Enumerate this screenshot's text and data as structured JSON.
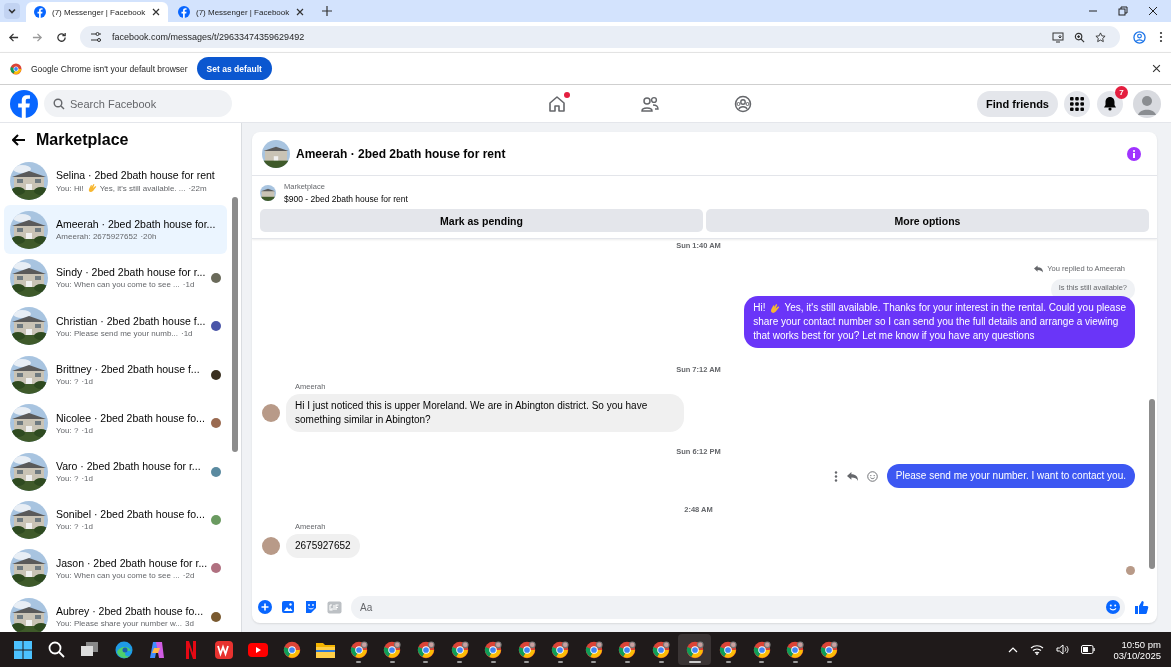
{
  "browser": {
    "tabs": [
      {
        "title": "(7) Messenger | Facebook",
        "selected": true
      },
      {
        "title": "(7) Messenger | Facebook",
        "selected": false
      }
    ],
    "address": "facebook.com/messages/t/29633474359629492",
    "infobar": {
      "text": "Google Chrome isn't your default browser",
      "button": "Set as default"
    }
  },
  "header": {
    "search": {
      "placeholder": "Search Facebook"
    },
    "home_unread": true,
    "find_friends": "Find friends",
    "notifications": "7"
  },
  "sidebar": {
    "title": "Marketplace",
    "items": [
      {
        "title": "Selina · 2bed 2bath house for rent",
        "lead": "You: Hi!",
        "preview": "Yes, it's still available. ...",
        "time": "·22m",
        "selected": false,
        "seen": false
      },
      {
        "title": "Ameerah · 2bed 2bath house for...",
        "preview": "Ameerah: 2675927652",
        "time": "·20h",
        "selected": true,
        "seen": false
      },
      {
        "title": "Sindy · 2bed 2bath house for r...",
        "preview": "You: When can you come to see ...",
        "time": "·1d",
        "selected": false,
        "seen": true,
        "color": "#6a6a5a"
      },
      {
        "title": "Christian · 2bed 2bath house f...",
        "preview": "You: Please send me your numb...",
        "time": "·1d",
        "selected": false,
        "seen": true,
        "color": "#4a55a8"
      },
      {
        "title": "Brittney · 2bed 2bath house f...",
        "preview": "You: ?",
        "time": "·1d",
        "selected": false,
        "seen": true,
        "color": "#3a3020"
      },
      {
        "title": "Nicolee · 2bed 2bath house fo...",
        "preview": "You: ?",
        "time": "·1d",
        "selected": false,
        "seen": true,
        "color": "#9a6a50"
      },
      {
        "title": "Varo · 2bed 2bath house for r...",
        "preview": "You: ?",
        "time": "·1d",
        "selected": false,
        "seen": true,
        "color": "#5a8aa0"
      },
      {
        "title": "Sonibel · 2bed 2bath house fo...",
        "preview": "You: ?",
        "time": "·1d",
        "selected": false,
        "seen": true,
        "color": "#6a9a60"
      },
      {
        "title": "Jason · 2bed 2bath house for r...",
        "preview": "You: When can you come to see ...",
        "time": "·2d",
        "selected": false,
        "seen": true,
        "color": "#b07080"
      },
      {
        "title": "Aubrey · 2bed 2bath house fo...",
        "preview": "You: Please share your number w...",
        "time": "3d",
        "selected": false,
        "seen": true,
        "color": "#7a5a30"
      }
    ]
  },
  "chat": {
    "title": "Ameerah · 2bed 2bath house for rent",
    "listing": {
      "label": "Marketplace",
      "text": "$900 - 2bed 2bath house for rent"
    },
    "actions": [
      "Mark as pending",
      "More options"
    ],
    "messages": [
      {
        "kind": "time",
        "text": "Sun 1:40 AM"
      },
      {
        "kind": "reply_note",
        "text": "You replied to Ameerah"
      },
      {
        "kind": "quote",
        "text": "Is this still available?"
      },
      {
        "kind": "outgoing",
        "lead": "Hi!",
        "lines": [
          "Yes, it's still available. Thanks for your interest in the rental. Could you please",
          "share your contact number so I can send you the full details and arrange a viewing",
          "that works best for you? Let me know if you have any questions"
        ],
        "color": "#6a35f8",
        "tools": false
      },
      {
        "kind": "time",
        "text": "Sun 7:12 AM"
      },
      {
        "kind": "incoming",
        "sender": "Ameerah",
        "text": "Hi I just noticed this is upper Moreland. We are in Abington district. So you have something similar in Abington?"
      },
      {
        "kind": "time",
        "text": "Sun 6:12 PM"
      },
      {
        "kind": "outgoing",
        "text": "Please send me your number. I want to contact you.",
        "color": "#3c57f2",
        "tools": true
      },
      {
        "kind": "time",
        "text": "2:48 AM"
      },
      {
        "kind": "incoming",
        "sender": "Ameerah",
        "text": "2675927652"
      }
    ],
    "composer": {
      "placeholder": "Aa"
    }
  },
  "taskbar": {
    "apps": [
      {
        "kind": "start"
      },
      {
        "kind": "search"
      },
      {
        "kind": "taskview"
      },
      {
        "kind": "edge"
      },
      {
        "kind": "copilot"
      },
      {
        "kind": "netflix"
      },
      {
        "kind": "wps"
      },
      {
        "kind": "youtube"
      },
      {
        "kind": "chrome"
      },
      {
        "kind": "folder"
      }
    ],
    "windows": [
      {
        "selected": false
      },
      {
        "selected": false
      },
      {
        "selected": false
      },
      {
        "selected": false
      },
      {
        "selected": false
      },
      {
        "selected": false
      },
      {
        "selected": false
      },
      {
        "selected": false
      },
      {
        "selected": false
      },
      {
        "selected": false
      },
      {
        "selected": true
      },
      {
        "selected": false
      },
      {
        "selected": false
      },
      {
        "selected": false
      },
      {
        "selected": false
      }
    ],
    "time": "10:50 pm",
    "date": "03/10/2025"
  }
}
